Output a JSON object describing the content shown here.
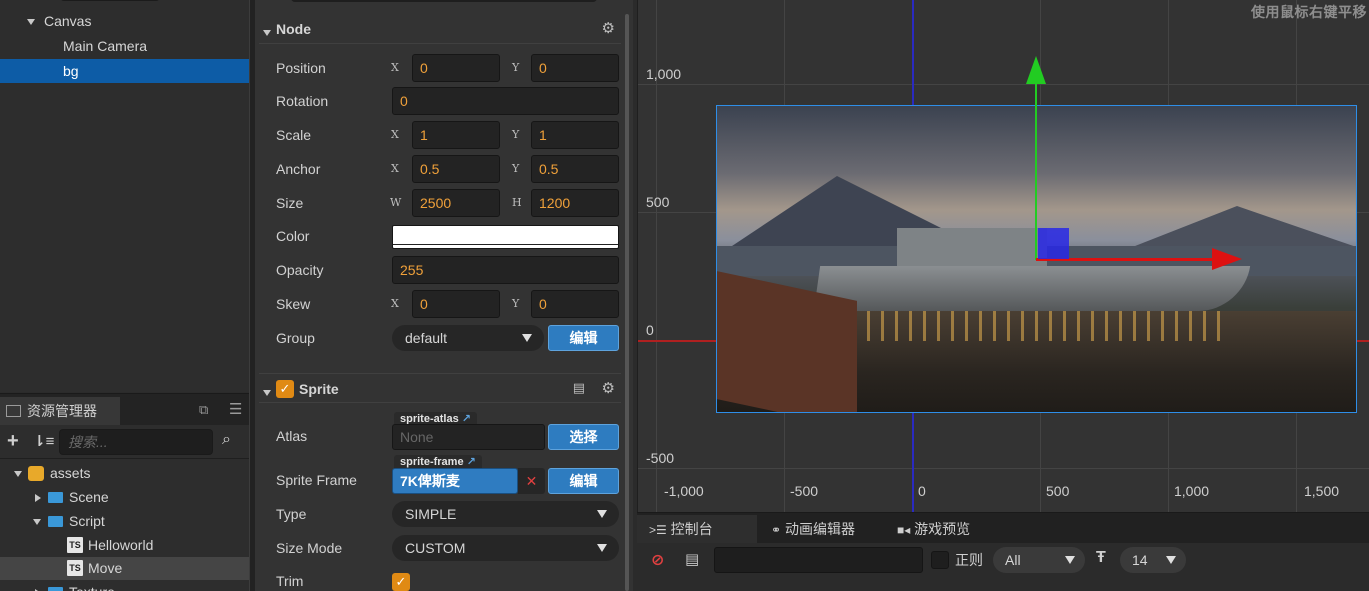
{
  "hierarchy": {
    "items": [
      {
        "label": "Canvas"
      },
      {
        "label": "Main Camera"
      },
      {
        "label": "bg"
      }
    ]
  },
  "assets": {
    "tab_label": "资源管理器",
    "search_placeholder": "搜索...",
    "items": [
      {
        "label": "assets"
      },
      {
        "label": "Scene"
      },
      {
        "label": "Script"
      },
      {
        "label": "Helloworld"
      },
      {
        "label": "Move"
      },
      {
        "label": "Texture"
      }
    ],
    "ts_badge": "TS"
  },
  "inspector": {
    "node": {
      "title": "Node",
      "position": {
        "label": "Position",
        "x_axis": "X",
        "x": "0",
        "y_axis": "Y",
        "y": "0"
      },
      "rotation": {
        "label": "Rotation",
        "value": "0"
      },
      "scale": {
        "label": "Scale",
        "x_axis": "X",
        "x": "1",
        "y_axis": "Y",
        "y": "1"
      },
      "anchor": {
        "label": "Anchor",
        "x_axis": "X",
        "x": "0.5",
        "y_axis": "Y",
        "y": "0.5"
      },
      "size": {
        "label": "Size",
        "w_axis": "W",
        "w": "2500",
        "h_axis": "H",
        "h": "1200"
      },
      "color": {
        "label": "Color",
        "value": "#ffffff"
      },
      "opacity": {
        "label": "Opacity",
        "value": "255"
      },
      "skew": {
        "label": "Skew",
        "x_axis": "X",
        "x": "0",
        "y_axis": "Y",
        "y": "0"
      },
      "group": {
        "label": "Group",
        "value": "default",
        "button": "编辑"
      }
    },
    "sprite": {
      "title": "Sprite",
      "enabled_mark": "✓",
      "atlas": {
        "label": "Atlas",
        "tag": "sprite-atlas",
        "value": "None",
        "button": "选择"
      },
      "sprite_frame": {
        "label": "Sprite Frame",
        "tag": "sprite-frame",
        "value": "7K俾斯麦",
        "clear": "✕",
        "button": "编辑"
      },
      "type": {
        "label": "Type",
        "value": "SIMPLE"
      },
      "size_mode": {
        "label": "Size Mode",
        "value": "CUSTOM"
      },
      "trim": {
        "label": "Trim",
        "mark": "✓"
      }
    }
  },
  "scene": {
    "hint": "使用鼠标右键平移",
    "y_ticks": [
      "1,000",
      "500",
      "0",
      "-500"
    ],
    "x_ticks": [
      "-1,000",
      "-500",
      "0",
      "500",
      "1,000",
      "1,500"
    ],
    "colors": {
      "x_axis": "#cc2222",
      "y_axis": "#2222cc",
      "selection": "#2e8ee8",
      "gizmo_green": "#22cc22",
      "gizmo_red": "#dd1111"
    }
  },
  "console": {
    "tabs": [
      {
        "label": "控制台"
      },
      {
        "label": "动画编辑器"
      },
      {
        "label": "游戏预览"
      }
    ],
    "regex_label": "正则",
    "level": "All",
    "font_size": "14"
  }
}
